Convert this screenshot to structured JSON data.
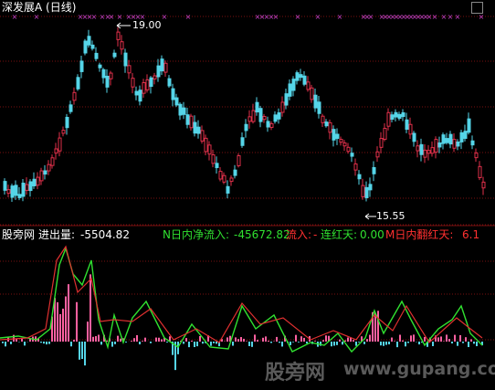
{
  "top": {
    "title": "深发展A",
    "period": "(日线)",
    "high_label": "19.00",
    "low_label": "15.55"
  },
  "indicator": {
    "name": "股旁网",
    "jinchu_label": "进出量:",
    "jinchu_value": "-5504.82",
    "nri_label": "N日内净流入:",
    "nri_value": "-45672.82",
    "liuru_label": "流入:",
    "liuru_value": "-",
    "lianhong_label": "连红天:",
    "lianhong_value": "0.00",
    "mri_label": "M日内翻红天:",
    "mri_value": "6.1"
  },
  "watermark": {
    "cn": "股旁网",
    "url": "www.gupang.com"
  },
  "colors": {
    "bg": "#000000",
    "up": "#e0304a",
    "down": "#55d5e8",
    "grid": "#7a1010",
    "signal": "#cc44cc",
    "green_line": "#30e030",
    "red_line": "#e03030",
    "label_white": "#ffffff",
    "label_green": "#30e030",
    "label_red": "#ff3030",
    "label_yellow": "#e0e000"
  }
}
